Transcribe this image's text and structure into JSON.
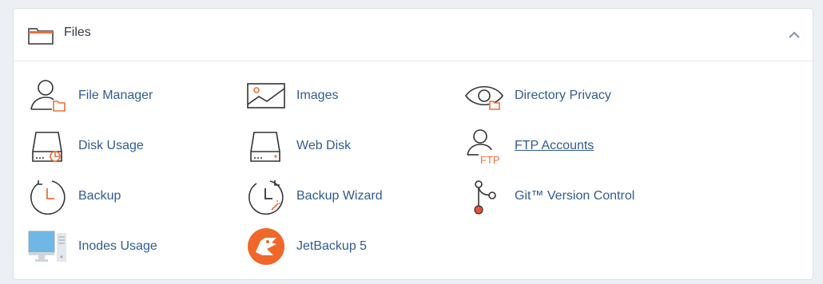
{
  "section": {
    "title": "Files",
    "collapse_icon": "chevron-up-icon",
    "header_icon": "folder-icon"
  },
  "colors": {
    "link": "#2f5c8f",
    "accent": "#e8713a",
    "icon_stroke": "#333333",
    "monitor_blue": "#6fb8e6"
  },
  "items": [
    {
      "label": "File Manager",
      "icon": "file-manager-icon"
    },
    {
      "label": "Images",
      "icon": "images-icon"
    },
    {
      "label": "Directory Privacy",
      "icon": "directory-privacy-icon"
    },
    {
      "label": "Disk Usage",
      "icon": "disk-usage-icon"
    },
    {
      "label": "Web Disk",
      "icon": "web-disk-icon"
    },
    {
      "label": "FTP Accounts",
      "icon": "ftp-accounts-icon",
      "icon_text": "FTP"
    },
    {
      "label": "Backup",
      "icon": "backup-icon"
    },
    {
      "label": "Backup Wizard",
      "icon": "backup-wizard-icon"
    },
    {
      "label": "Git™ Version Control",
      "icon": "git-version-control-icon"
    },
    {
      "label": "Inodes Usage",
      "icon": "inodes-usage-icon"
    },
    {
      "label": "JetBackup 5",
      "icon": "jetbackup-icon"
    }
  ]
}
